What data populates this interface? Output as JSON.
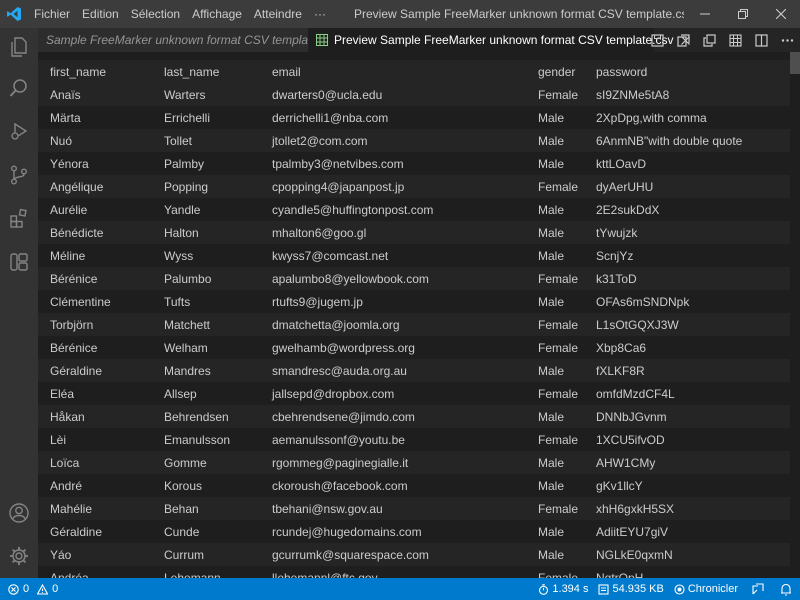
{
  "titlebar": {
    "menu": [
      "Fichier",
      "Edition",
      "Sélection",
      "Affichage",
      "Atteindre",
      "···"
    ],
    "title": "Preview Sample FreeMarker unknown format CSV template.csv - Hardis_..."
  },
  "tabs": [
    {
      "label": "Sample FreeMarker unknown format CSV template"
    },
    {
      "label": "Preview Sample FreeMarker unknown format CSV template.csv"
    }
  ],
  "table": {
    "columns": [
      "first_name",
      "last_name",
      "email",
      "gender",
      "password"
    ],
    "rows": [
      [
        "Anaïs",
        "Warters",
        "dwarters0@ucla.edu",
        "Female",
        "sI9ZNMe5tA8"
      ],
      [
        "Märta",
        "Errichelli",
        "derrichelli1@nba.com",
        "Male",
        "2XpDpg,with comma"
      ],
      [
        "Nuó",
        "Tollet",
        "jtollet2@com.com",
        "Male",
        "6AnmNB\"with double quote"
      ],
      [
        "Yénora",
        "Palmby",
        "tpalmby3@netvibes.com",
        "Male",
        "kttLOavD"
      ],
      [
        "Angélique",
        "Popping",
        "cpopping4@japanpost.jp",
        "Female",
        "dyAerUHU"
      ],
      [
        "Aurélie",
        "Yandle",
        "cyandle5@huffingtonpost.com",
        "Male",
        "2E2sukDdX"
      ],
      [
        "Bénédicte",
        "Halton",
        "mhalton6@goo.gl",
        "Male",
        "tYwujzk"
      ],
      [
        "Méline",
        "Wyss",
        "kwyss7@comcast.net",
        "Male",
        "ScnjYz"
      ],
      [
        "Bérénice",
        "Palumbo",
        "apalumbo8@yellowbook.com",
        "Female",
        "k31ToD"
      ],
      [
        "Clémentine",
        "Tufts",
        "rtufts9@jugem.jp",
        "Male",
        "OFAs6mSNDNpk"
      ],
      [
        "Torbjörn",
        "Matchett",
        "dmatchetta@joomla.org",
        "Female",
        "L1sOtGQXJ3W"
      ],
      [
        "Bérénice",
        "Welham",
        "gwelhamb@wordpress.org",
        "Female",
        "Xbp8Ca6"
      ],
      [
        "Géraldine",
        "Mandres",
        "smandresc@auda.org.au",
        "Male",
        "fXLKF8R"
      ],
      [
        "Eléa",
        "Allsep",
        "jallsepd@dropbox.com",
        "Female",
        "omfdMzdCF4L"
      ],
      [
        "Håkan",
        "Behrendsen",
        "cbehrendsene@jimdo.com",
        "Male",
        "DNNbJGvnm"
      ],
      [
        "Lèi",
        "Emanulsson",
        "aemanulssonf@youtu.be",
        "Female",
        "1XCU5ifvOD"
      ],
      [
        "Loïca",
        "Gomme",
        "rgommeg@paginegialle.it",
        "Male",
        "AHW1CMy"
      ],
      [
        "André",
        "Korous",
        "ckoroush@facebook.com",
        "Male",
        "gKv1llcY"
      ],
      [
        "Mahélie",
        "Behan",
        "tbehani@nsw.gov.au",
        "Female",
        "xhH6gxkH5SX"
      ],
      [
        "Géraldine",
        "Cunde",
        "rcundej@hugedomains.com",
        "Male",
        "AdiitEYU7giV"
      ],
      [
        "Yáo",
        "Currum",
        "gcurrumk@squarespace.com",
        "Male",
        "NGLkE0qxmN"
      ],
      [
        "Andréa",
        "Lehemann",
        "llehemannl@ftc.gov",
        "Female",
        "NqtrOpH"
      ]
    ]
  },
  "statusbar": {
    "errors": "0",
    "warnings": "0",
    "timing": "1.394 s",
    "filesize": "54.935 KB",
    "chronicler": "Chronicler"
  },
  "colors": {
    "statusbar": "#007acc",
    "titlebar": "#3c3c3c",
    "activitybar": "#333333",
    "editor": "#1e1e1e"
  }
}
